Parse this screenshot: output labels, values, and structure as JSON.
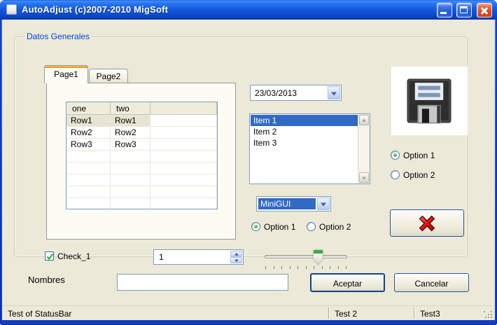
{
  "window": {
    "title": "AutoAdjust (c)2007-2010 MigSoft"
  },
  "groupbox": {
    "label": "Datos Generales"
  },
  "tabs": [
    {
      "label": "Page1",
      "active": true
    },
    {
      "label": "Page2",
      "active": false
    }
  ],
  "grid": {
    "columns": [
      "one",
      "two",
      ""
    ],
    "rows": [
      [
        "Row1",
        "Row1",
        ""
      ],
      [
        "Row2",
        "Row2",
        ""
      ],
      [
        "Row3",
        "Row3",
        ""
      ]
    ],
    "selected_row_index": 0,
    "empty_row_count": 5
  },
  "datepicker": {
    "value": "23/03/2013"
  },
  "listbox": {
    "items": [
      "Item 1",
      "Item 2",
      "Item 3"
    ],
    "selected_index": 0
  },
  "image_box": {
    "icon": "floppy-disk-icon"
  },
  "radio_group_right": {
    "options": [
      {
        "label": "Option 1",
        "selected": true
      },
      {
        "label": "Option 2",
        "selected": false
      }
    ]
  },
  "combobox": {
    "value": "MiniGUI"
  },
  "radio_group_middle": {
    "options": [
      {
        "label": "Option 1",
        "selected": true
      },
      {
        "label": "Option 2",
        "selected": false
      }
    ]
  },
  "delete_button": {
    "icon": "red-x-icon"
  },
  "checkbox": {
    "label": "Check_1",
    "checked": true
  },
  "spinner": {
    "value": "1"
  },
  "slider": {
    "value_percent": 64,
    "tick_count": 11
  },
  "form": {
    "label": "Nombres",
    "input_value": ""
  },
  "action_buttons": {
    "accept": "Aceptar",
    "cancel": "Cancelar"
  },
  "statusbar": {
    "panels": [
      "Test of StatusBar",
      "Test 2",
      "Test3"
    ]
  },
  "colors": {
    "titlebar_blue": "#1659DD",
    "client_bg": "#ECE9D8",
    "selection_blue": "#316AC5",
    "groupbox_label_blue": "#0046D5",
    "tab_accent_orange": "#F0A028",
    "button_border_blue": "#26569E",
    "close_button_red": "#D84A20",
    "check_green": "#2FA52F"
  }
}
